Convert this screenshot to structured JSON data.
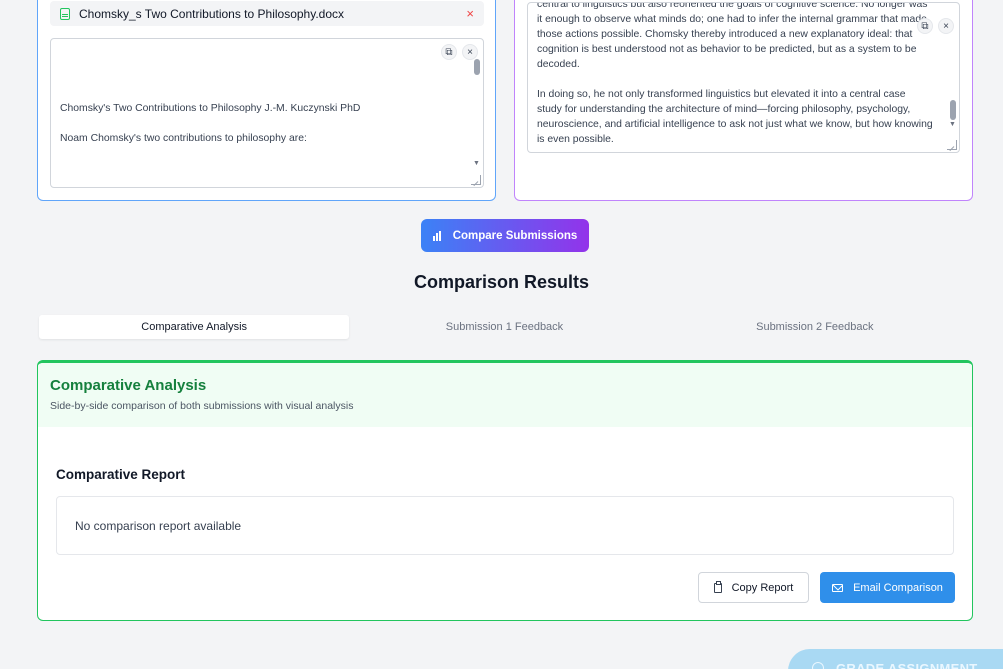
{
  "submission1": {
    "file_name": "Chomsky_s Two Contributions to Philosophy.docx",
    "remove_label": "×",
    "text": "Chomsky's Two Contributions to Philosophy J.-M. Kuczynski PhD\n\nNoam Chomsky's two contributions to philosophy are:",
    "copy_icon": "copy-icon",
    "close_label": "×"
  },
  "submission2": {
    "text": "central to linguistics but also reoriented the goals of cognitive science. No longer was it enough to observe what minds do; one had to infer the internal grammar that made those actions possible. Chomsky thereby introduced a new explanatory ideal: that cognition is best understood not as behavior to be predicted, but as a system to be decoded.\n\nIn doing so, he not only transformed linguistics but elevated it into a central case study for understanding the architecture of mind—forcing philosophy, psychology, neuroscience, and artificial intelligence to ask not just what we know, but how knowing is even possible.",
    "close_label": "×"
  },
  "compare_button": {
    "label": "Compare Submissions",
    "icon": "bar-chart-icon"
  },
  "results": {
    "title": "Comparison Results",
    "tabs": [
      {
        "label": "Comparative Analysis",
        "active": true
      },
      {
        "label": "Submission 1 Feedback",
        "active": false
      },
      {
        "label": "Submission 2 Feedback",
        "active": false
      }
    ]
  },
  "analysis_card": {
    "title": "Comparative Analysis",
    "subtitle": "Side-by-side comparison of both submissions with visual analysis",
    "report_heading": "Comparative Report",
    "report_text": "No comparison report available",
    "copy_button": "Copy Report",
    "email_button": "Email Comparison"
  },
  "grade_button": {
    "label": "GRADE ASSIGNMENT"
  },
  "colors": {
    "panel1_border": "#60a5fa",
    "panel2_border": "#c084fc",
    "card_accent": "#22c55e",
    "email_button": "#2f8fea"
  }
}
